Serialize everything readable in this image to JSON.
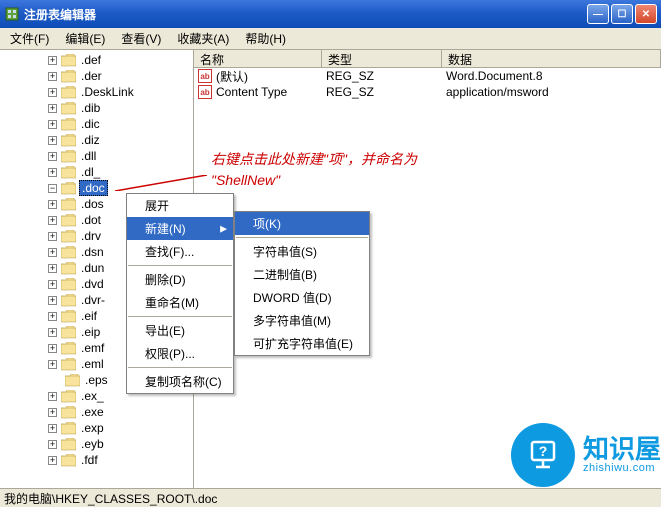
{
  "window": {
    "title": "注册表编辑器"
  },
  "menubar": [
    "文件(F)",
    "编辑(E)",
    "查看(V)",
    "收藏夹(A)",
    "帮助(H)"
  ],
  "tree": {
    "selected": ".doc",
    "items": [
      {
        "exp": "plus",
        "label": ".def"
      },
      {
        "exp": "plus",
        "label": ".der"
      },
      {
        "exp": "plus",
        "label": ".DeskLink"
      },
      {
        "exp": "plus",
        "label": ".dib"
      },
      {
        "exp": "plus",
        "label": ".dic"
      },
      {
        "exp": "plus",
        "label": ".diz"
      },
      {
        "exp": "plus",
        "label": ".dll"
      },
      {
        "exp": "plus",
        "label": ".dl_"
      },
      {
        "exp": "dash",
        "label": ".doc",
        "selected": true
      },
      {
        "exp": "plus",
        "label": ".dos"
      },
      {
        "exp": "plus",
        "label": ".dot"
      },
      {
        "exp": "plus",
        "label": ".drv"
      },
      {
        "exp": "plus",
        "label": ".dsn"
      },
      {
        "exp": "plus",
        "label": ".dun"
      },
      {
        "exp": "plus",
        "label": ".dvd"
      },
      {
        "exp": "plus",
        "label": ".dvr-"
      },
      {
        "exp": "plus",
        "label": ".eif"
      },
      {
        "exp": "plus",
        "label": ".eip"
      },
      {
        "exp": "plus",
        "label": ".emf"
      },
      {
        "exp": "plus",
        "label": ".eml"
      },
      {
        "exp": "none",
        "label": ".eps"
      },
      {
        "exp": "plus",
        "label": ".ex_"
      },
      {
        "exp": "plus",
        "label": ".exe"
      },
      {
        "exp": "plus",
        "label": ".exp"
      },
      {
        "exp": "plus",
        "label": ".eyb"
      },
      {
        "exp": "plus",
        "label": ".fdf"
      }
    ]
  },
  "list": {
    "headers": {
      "name": "名称",
      "type": "类型",
      "data": "数据"
    },
    "rows": [
      {
        "name": "(默认)",
        "type": "REG_SZ",
        "data": "Word.Document.8"
      },
      {
        "name": "Content Type",
        "type": "REG_SZ",
        "data": "application/msword"
      }
    ]
  },
  "context1": {
    "expand": "展开",
    "new": "新建(N)",
    "find": "查找(F)...",
    "delete": "删除(D)",
    "rename": "重命名(M)",
    "export": "导出(E)",
    "permissions": "权限(P)...",
    "copykey": "复制项名称(C)"
  },
  "context2": {
    "key": "项(K)",
    "string": "字符串值(S)",
    "binary": "二进制值(B)",
    "dword": "DWORD 值(D)",
    "multistring": "多字符串值(M)",
    "expandstring": "可扩充字符串值(E)"
  },
  "annotation": {
    "line1": "右键点击此处新建\"项\"，并命名为",
    "line2": "\"ShellNew\""
  },
  "statusbar": "我的电脑\\HKEY_CLASSES_ROOT\\.doc",
  "watermark": {
    "cn": "知识屋",
    "url": "zhishiwu.com"
  }
}
